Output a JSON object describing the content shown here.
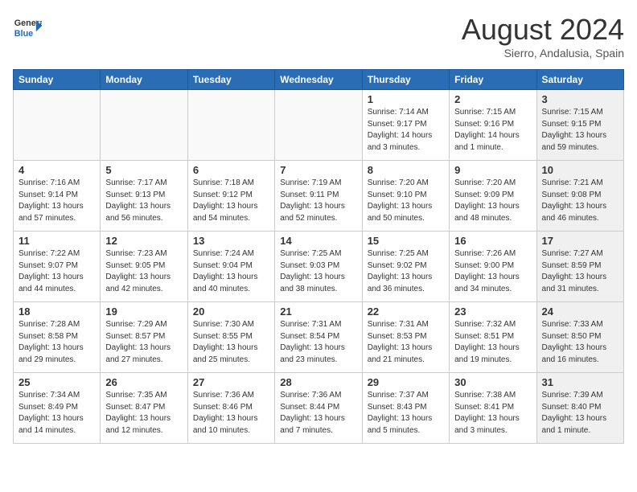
{
  "header": {
    "logo_text_general": "General",
    "logo_text_blue": "Blue",
    "month": "August 2024",
    "location": "Sierro, Andalusia, Spain"
  },
  "weekdays": [
    "Sunday",
    "Monday",
    "Tuesday",
    "Wednesday",
    "Thursday",
    "Friday",
    "Saturday"
  ],
  "weeks": [
    [
      {
        "day": "",
        "info": "",
        "empty": true
      },
      {
        "day": "",
        "info": "",
        "empty": true
      },
      {
        "day": "",
        "info": "",
        "empty": true
      },
      {
        "day": "",
        "info": "",
        "empty": true
      },
      {
        "day": "1",
        "info": "Sunrise: 7:14 AM\nSunset: 9:17 PM\nDaylight: 14 hours\nand 3 minutes.",
        "empty": false
      },
      {
        "day": "2",
        "info": "Sunrise: 7:15 AM\nSunset: 9:16 PM\nDaylight: 14 hours\nand 1 minute.",
        "empty": false
      },
      {
        "day": "3",
        "info": "Sunrise: 7:15 AM\nSunset: 9:15 PM\nDaylight: 13 hours\nand 59 minutes.",
        "empty": false,
        "shaded": true
      }
    ],
    [
      {
        "day": "4",
        "info": "Sunrise: 7:16 AM\nSunset: 9:14 PM\nDaylight: 13 hours\nand 57 minutes.",
        "empty": false
      },
      {
        "day": "5",
        "info": "Sunrise: 7:17 AM\nSunset: 9:13 PM\nDaylight: 13 hours\nand 56 minutes.",
        "empty": false
      },
      {
        "day": "6",
        "info": "Sunrise: 7:18 AM\nSunset: 9:12 PM\nDaylight: 13 hours\nand 54 minutes.",
        "empty": false
      },
      {
        "day": "7",
        "info": "Sunrise: 7:19 AM\nSunset: 9:11 PM\nDaylight: 13 hours\nand 52 minutes.",
        "empty": false
      },
      {
        "day": "8",
        "info": "Sunrise: 7:20 AM\nSunset: 9:10 PM\nDaylight: 13 hours\nand 50 minutes.",
        "empty": false
      },
      {
        "day": "9",
        "info": "Sunrise: 7:20 AM\nSunset: 9:09 PM\nDaylight: 13 hours\nand 48 minutes.",
        "empty": false
      },
      {
        "day": "10",
        "info": "Sunrise: 7:21 AM\nSunset: 9:08 PM\nDaylight: 13 hours\nand 46 minutes.",
        "empty": false,
        "shaded": true
      }
    ],
    [
      {
        "day": "11",
        "info": "Sunrise: 7:22 AM\nSunset: 9:07 PM\nDaylight: 13 hours\nand 44 minutes.",
        "empty": false
      },
      {
        "day": "12",
        "info": "Sunrise: 7:23 AM\nSunset: 9:05 PM\nDaylight: 13 hours\nand 42 minutes.",
        "empty": false
      },
      {
        "day": "13",
        "info": "Sunrise: 7:24 AM\nSunset: 9:04 PM\nDaylight: 13 hours\nand 40 minutes.",
        "empty": false
      },
      {
        "day": "14",
        "info": "Sunrise: 7:25 AM\nSunset: 9:03 PM\nDaylight: 13 hours\nand 38 minutes.",
        "empty": false
      },
      {
        "day": "15",
        "info": "Sunrise: 7:25 AM\nSunset: 9:02 PM\nDaylight: 13 hours\nand 36 minutes.",
        "empty": false
      },
      {
        "day": "16",
        "info": "Sunrise: 7:26 AM\nSunset: 9:00 PM\nDaylight: 13 hours\nand 34 minutes.",
        "empty": false
      },
      {
        "day": "17",
        "info": "Sunrise: 7:27 AM\nSunset: 8:59 PM\nDaylight: 13 hours\nand 31 minutes.",
        "empty": false,
        "shaded": true
      }
    ],
    [
      {
        "day": "18",
        "info": "Sunrise: 7:28 AM\nSunset: 8:58 PM\nDaylight: 13 hours\nand 29 minutes.",
        "empty": false
      },
      {
        "day": "19",
        "info": "Sunrise: 7:29 AM\nSunset: 8:57 PM\nDaylight: 13 hours\nand 27 minutes.",
        "empty": false
      },
      {
        "day": "20",
        "info": "Sunrise: 7:30 AM\nSunset: 8:55 PM\nDaylight: 13 hours\nand 25 minutes.",
        "empty": false
      },
      {
        "day": "21",
        "info": "Sunrise: 7:31 AM\nSunset: 8:54 PM\nDaylight: 13 hours\nand 23 minutes.",
        "empty": false
      },
      {
        "day": "22",
        "info": "Sunrise: 7:31 AM\nSunset: 8:53 PM\nDaylight: 13 hours\nand 21 minutes.",
        "empty": false
      },
      {
        "day": "23",
        "info": "Sunrise: 7:32 AM\nSunset: 8:51 PM\nDaylight: 13 hours\nand 19 minutes.",
        "empty": false
      },
      {
        "day": "24",
        "info": "Sunrise: 7:33 AM\nSunset: 8:50 PM\nDaylight: 13 hours\nand 16 minutes.",
        "empty": false,
        "shaded": true
      }
    ],
    [
      {
        "day": "25",
        "info": "Sunrise: 7:34 AM\nSunset: 8:49 PM\nDaylight: 13 hours\nand 14 minutes.",
        "empty": false
      },
      {
        "day": "26",
        "info": "Sunrise: 7:35 AM\nSunset: 8:47 PM\nDaylight: 13 hours\nand 12 minutes.",
        "empty": false
      },
      {
        "day": "27",
        "info": "Sunrise: 7:36 AM\nSunset: 8:46 PM\nDaylight: 13 hours\nand 10 minutes.",
        "empty": false
      },
      {
        "day": "28",
        "info": "Sunrise: 7:36 AM\nSunset: 8:44 PM\nDaylight: 13 hours\nand 7 minutes.",
        "empty": false
      },
      {
        "day": "29",
        "info": "Sunrise: 7:37 AM\nSunset: 8:43 PM\nDaylight: 13 hours\nand 5 minutes.",
        "empty": false
      },
      {
        "day": "30",
        "info": "Sunrise: 7:38 AM\nSunset: 8:41 PM\nDaylight: 13 hours\nand 3 minutes.",
        "empty": false
      },
      {
        "day": "31",
        "info": "Sunrise: 7:39 AM\nSunset: 8:40 PM\nDaylight: 13 hours\nand 1 minute.",
        "empty": false,
        "shaded": true
      }
    ]
  ]
}
